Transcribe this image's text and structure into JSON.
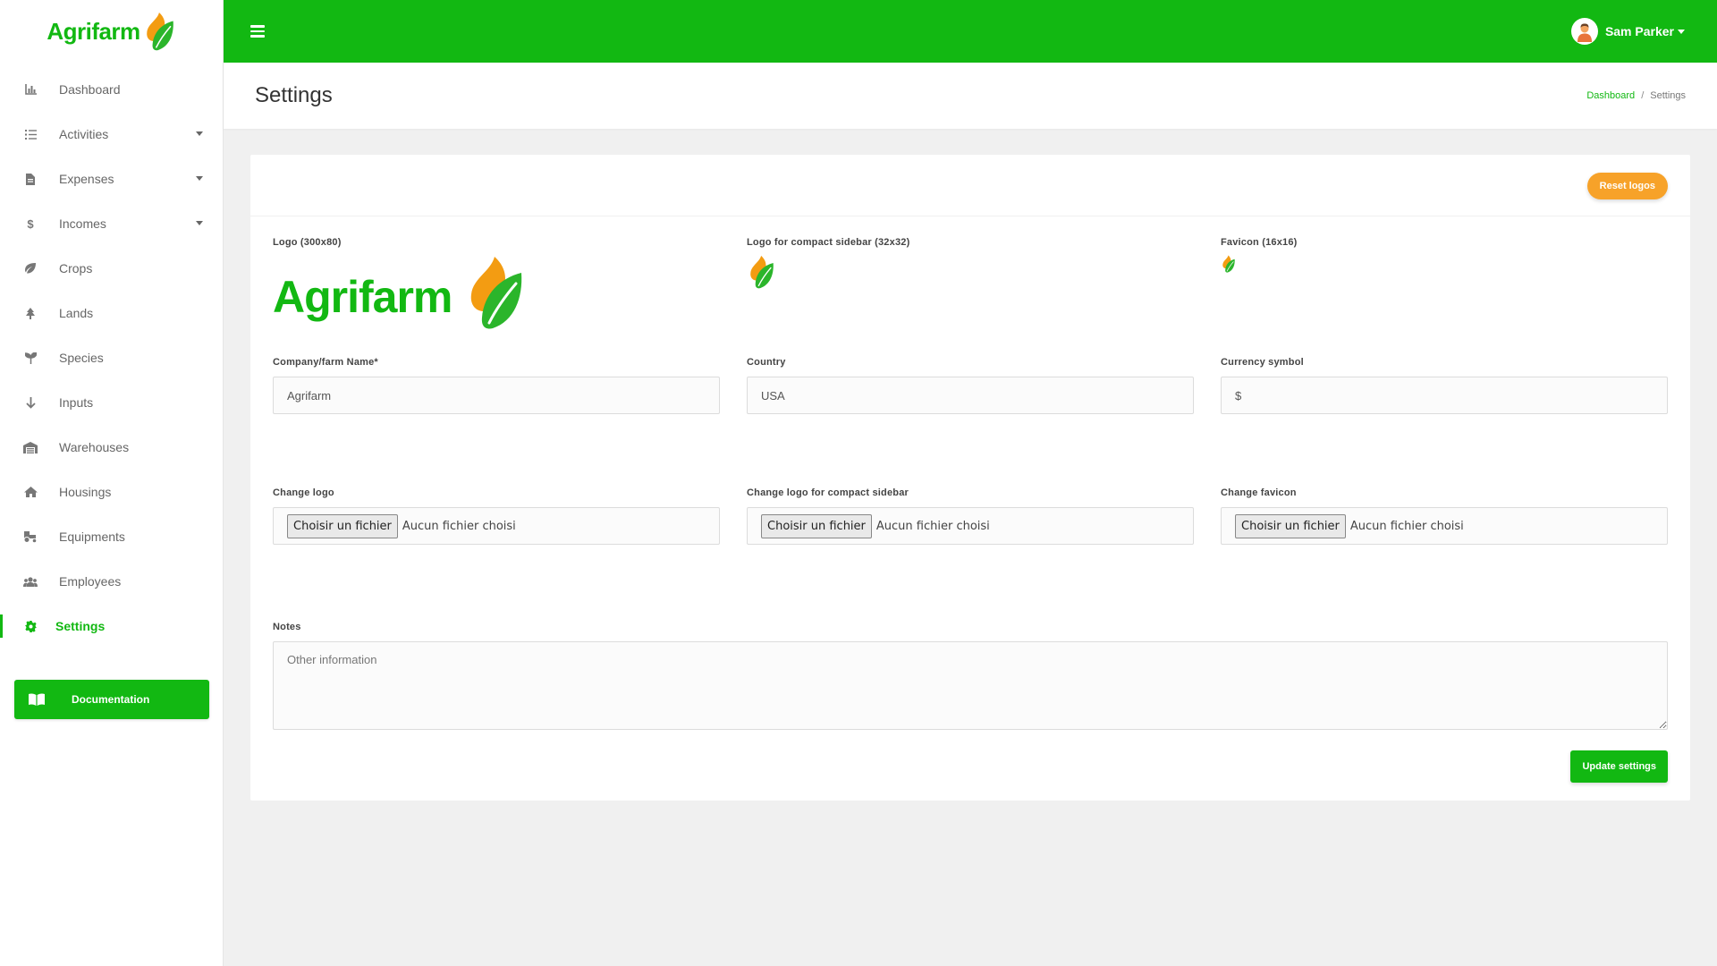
{
  "app": {
    "brand": "Agrifarm"
  },
  "topbar": {
    "menu_icon": "hamburger-icon",
    "user_name": "Sam Parker"
  },
  "sidebar": {
    "items": [
      {
        "label": "Dashboard",
        "icon": "chart-icon"
      },
      {
        "label": "Activities",
        "icon": "list-icon",
        "has_submenu": true
      },
      {
        "label": "Expenses",
        "icon": "document-icon",
        "has_submenu": true
      },
      {
        "label": "Incomes",
        "icon": "dollar-icon",
        "has_submenu": true
      },
      {
        "label": "Crops",
        "icon": "leaf-icon"
      },
      {
        "label": "Lands",
        "icon": "tree-icon"
      },
      {
        "label": "Species",
        "icon": "seedling-icon"
      },
      {
        "label": "Inputs",
        "icon": "arrow-down-icon"
      },
      {
        "label": "Warehouses",
        "icon": "warehouse-icon"
      },
      {
        "label": "Housings",
        "icon": "home-icon"
      },
      {
        "label": "Equipments",
        "icon": "tractor-icon"
      },
      {
        "label": "Employees",
        "icon": "users-icon"
      },
      {
        "label": "Settings",
        "icon": "gear-icon",
        "active": true
      }
    ],
    "documentation_label": "Documentation"
  },
  "page": {
    "title": "Settings",
    "breadcrumb": {
      "home": "Dashboard",
      "separator": "/",
      "current": "Settings"
    }
  },
  "form": {
    "reset_logos_label": "Reset logos",
    "logo_label": "Logo (300x80)",
    "logo_text": "Agrifarm",
    "compact_logo_label": "Logo for compact sidebar (32x32)",
    "favicon_label": "Favicon (16x16)",
    "company_label": "Company/farm Name*",
    "company_value": "Agrifarm",
    "country_label": "Country",
    "country_value": "USA",
    "currency_label": "Currency symbol",
    "currency_value": "$",
    "change_logo_label": "Change logo",
    "change_compact_logo_label": "Change logo for compact sidebar",
    "change_favicon_label": "Change favicon",
    "file_button_label": "Choisir un fichier",
    "file_status": "Aucun fichier choisi",
    "notes_label": "Notes",
    "notes_placeholder": "Other information",
    "update_label": "Update settings"
  },
  "colors": {
    "primary": "#12b812",
    "accent_orange": "#f7a229",
    "leaf_orange": "#f39c12",
    "leaf_green": "#2bb52b"
  }
}
